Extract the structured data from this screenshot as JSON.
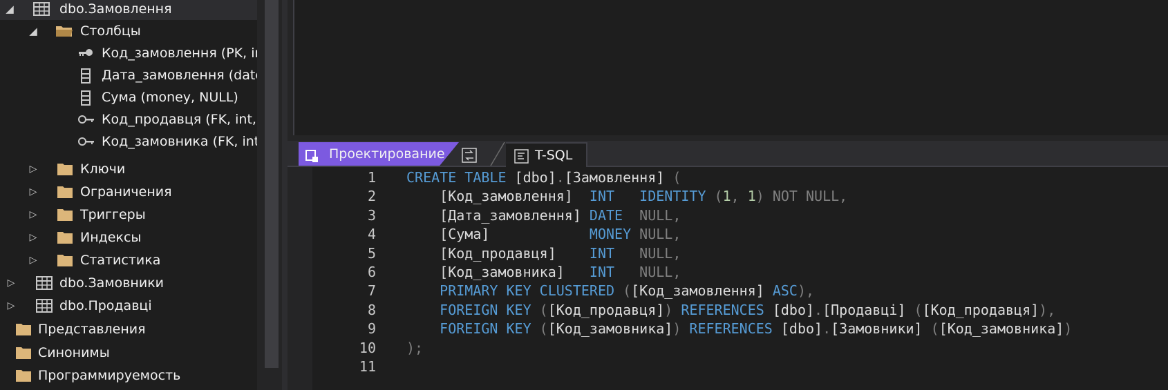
{
  "explorer": {
    "items": [
      {
        "label": "dbo.Замовлення",
        "icon": "table-icon",
        "expanded": true
      },
      {
        "label": "Столбцы",
        "icon": "folder-icon",
        "expanded": true
      },
      {
        "label": "Код_замовлення (PK, in",
        "icon": "primary-key-icon"
      },
      {
        "label": "Дата_замовлення (date",
        "icon": "column-icon"
      },
      {
        "label": "Сума (money, NULL)",
        "icon": "column-icon"
      },
      {
        "label": "Код_продавця (FK, int, N",
        "icon": "foreign-key-icon"
      },
      {
        "label": "Код_замовника (FK, int,",
        "icon": "foreign-key-icon"
      },
      {
        "label": "Ключи",
        "icon": "folder-icon",
        "expanded": false
      },
      {
        "label": "Ограничения",
        "icon": "folder-icon",
        "expanded": false
      },
      {
        "label": "Триггеры",
        "icon": "folder-icon",
        "expanded": false
      },
      {
        "label": "Индексы",
        "icon": "folder-icon",
        "expanded": false
      },
      {
        "label": "Статистика",
        "icon": "folder-icon",
        "expanded": false
      },
      {
        "label": "dbo.Замовники",
        "icon": "table-icon",
        "expanded": false
      },
      {
        "label": "dbo.Продавці",
        "icon": "table-icon",
        "expanded": false
      },
      {
        "label": "Представления",
        "icon": "folder-icon"
      },
      {
        "label": "Синонимы",
        "icon": "folder-icon"
      },
      {
        "label": "Программируемость",
        "icon": "folder-icon"
      }
    ]
  },
  "tabs": {
    "design_label": "Проектирование",
    "swap_icon": "swap-panes-icon",
    "tsql_label": "T-SQL"
  },
  "editor": {
    "lines": [
      {
        "n": "1",
        "tokens": [
          [
            "kw",
            "CREATE TABLE "
          ],
          [
            "id",
            "[dbo]"
          ],
          [
            "gr",
            "."
          ],
          [
            "id",
            "[Замовлення]"
          ],
          [
            "gr",
            " ("
          ]
        ]
      },
      {
        "n": "2",
        "tokens": [
          [
            "id",
            "    [Код_замовлення]  "
          ],
          [
            "kw",
            "INT   IDENTITY "
          ],
          [
            "gr",
            "("
          ],
          [
            "num",
            "1"
          ],
          [
            "gr",
            ", "
          ],
          [
            "num",
            "1"
          ],
          [
            "gr",
            ") NOT NULL,"
          ]
        ]
      },
      {
        "n": "3",
        "tokens": [
          [
            "id",
            "    [Дата_замовлення] "
          ],
          [
            "kw",
            "DATE  "
          ],
          [
            "gr",
            "NULL,"
          ]
        ]
      },
      {
        "n": "4",
        "tokens": [
          [
            "id",
            "    [Сума]            "
          ],
          [
            "kw",
            "MONEY "
          ],
          [
            "gr",
            "NULL,"
          ]
        ]
      },
      {
        "n": "5",
        "tokens": [
          [
            "id",
            "    [Код_продавця]    "
          ],
          [
            "kw",
            "INT   "
          ],
          [
            "gr",
            "NULL,"
          ]
        ]
      },
      {
        "n": "6",
        "tokens": [
          [
            "id",
            "    [Код_замовника]   "
          ],
          [
            "kw",
            "INT   "
          ],
          [
            "gr",
            "NULL,"
          ]
        ]
      },
      {
        "n": "7",
        "tokens": [
          [
            "kw",
            "    PRIMARY KEY CLUSTERED "
          ],
          [
            "gr",
            "("
          ],
          [
            "id",
            "[Код_замовлення] "
          ],
          [
            "kw",
            "ASC"
          ],
          [
            "gr",
            "),"
          ]
        ]
      },
      {
        "n": "8",
        "tokens": [
          [
            "kw",
            "    FOREIGN KEY "
          ],
          [
            "gr",
            "("
          ],
          [
            "id",
            "[Код_продавця]"
          ],
          [
            "gr",
            ") "
          ],
          [
            "kw",
            "REFERENCES "
          ],
          [
            "id",
            "[dbo]"
          ],
          [
            "gr",
            "."
          ],
          [
            "id",
            "[Продавці] "
          ],
          [
            "gr",
            "("
          ],
          [
            "id",
            "[Код_продавця]"
          ],
          [
            "gr",
            "),"
          ]
        ]
      },
      {
        "n": "9",
        "tokens": [
          [
            "kw",
            "    FOREIGN KEY "
          ],
          [
            "gr",
            "("
          ],
          [
            "id",
            "[Код_замовника]"
          ],
          [
            "gr",
            ") "
          ],
          [
            "kw",
            "REFERENCES "
          ],
          [
            "id",
            "[dbo]"
          ],
          [
            "gr",
            "."
          ],
          [
            "id",
            "[Замовники] "
          ],
          [
            "gr",
            "("
          ],
          [
            "id",
            "[Код_замовника]"
          ],
          [
            "gr",
            ")"
          ]
        ]
      },
      {
        "n": "10",
        "tokens": [
          [
            "gr",
            ");"
          ]
        ]
      },
      {
        "n": "11",
        "tokens": []
      }
    ]
  },
  "colors": {
    "background": "#1e1e1e",
    "keyword": "#569cd6",
    "identifier": "#dcdcdc",
    "punctuation": "#808080",
    "number": "#b5cea8",
    "active_tab": "#7c5ae0",
    "folder": "#dcb67a"
  }
}
